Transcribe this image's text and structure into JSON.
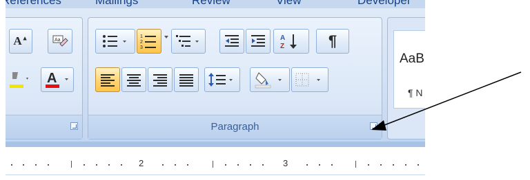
{
  "tabs": [
    "References",
    "Mailings",
    "Review",
    "View",
    "Developer"
  ],
  "group": {
    "label": "Paragraph"
  },
  "style_gallery": {
    "sample": "AaB",
    "caption": "¶ N"
  },
  "ruler": {
    "numbers": [
      "2",
      "3"
    ]
  },
  "colors": {
    "font_color_underline": "#e81010",
    "highlight_underline": "#f2e600",
    "active_button": "#ffc44a"
  },
  "icons": [
    "grow-font-icon",
    "clear-formatting-icon",
    "highlight-icon",
    "font-color-icon",
    "bullets-icon",
    "numbering-icon",
    "multilevel-list-icon",
    "decrease-indent-icon",
    "increase-indent-icon",
    "sort-icon",
    "show-formatting-marks-icon",
    "align-left-icon",
    "center-icon",
    "align-right-icon",
    "justify-icon",
    "line-spacing-icon",
    "shading-icon",
    "borders-icon",
    "dialog-launcher-icon",
    "arrow-annotation"
  ]
}
